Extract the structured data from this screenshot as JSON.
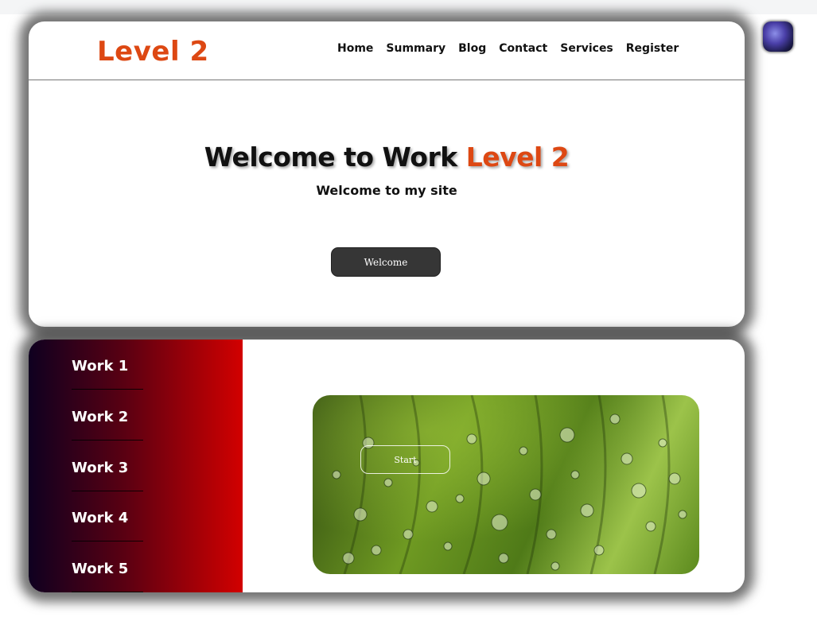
{
  "header": {
    "logo": "Level 2",
    "nav": [
      "Home",
      "Summary",
      "Blog",
      "Contact",
      "Services",
      "Register"
    ]
  },
  "hero": {
    "title_prefix": "Welcome to Work",
    "title_accent": "Level 2",
    "subtitle": "Welcome to my site",
    "button": "Welcome"
  },
  "works": {
    "items": [
      "Work 1",
      "Work 2",
      "Work 3",
      "Work 4",
      "Work 5"
    ],
    "start_button": "Start"
  },
  "colors": {
    "accent": "#dd4813",
    "sidebar_gradient_start": "#0f0020",
    "sidebar_gradient_end": "#d20000",
    "button_dark": "#363636"
  },
  "icons": {
    "avatar": "galaxy-avatar-icon"
  }
}
